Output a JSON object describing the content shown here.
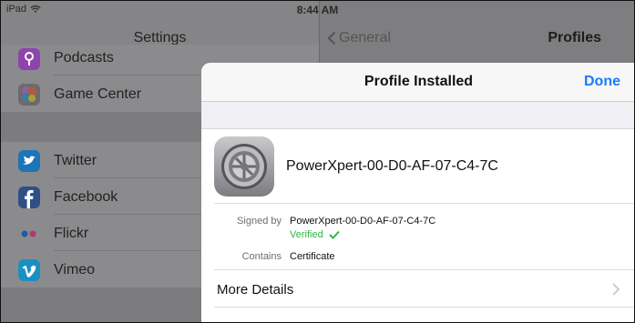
{
  "status": {
    "device": "iPad",
    "time": "8:44 AM"
  },
  "left": {
    "title": "Settings",
    "items": [
      {
        "label": "Podcasts",
        "icon": "podcasts-icon",
        "color": "#8e44ad"
      },
      {
        "label": "Game Center",
        "icon": "game-center-icon",
        "color": "#5b8b3a"
      },
      {
        "label": "Twitter",
        "icon": "twitter-icon",
        "color": "#1d74b8"
      },
      {
        "label": "Facebook",
        "icon": "facebook-icon",
        "color": "#2f4f86"
      },
      {
        "label": "Flickr",
        "icon": "flickr-icon",
        "color": "#7e7e80"
      },
      {
        "label": "Vimeo",
        "icon": "vimeo-icon",
        "color": "#1c8fc1"
      }
    ]
  },
  "right": {
    "back_label": "General",
    "title": "Profiles"
  },
  "sheet": {
    "title": "Profile Installed",
    "done_label": "Done",
    "profile_name": "PowerXpert-00-D0-AF-07-C4-7C",
    "signed_by_label": "Signed by",
    "signed_by_value": "PowerXpert-00-D0-AF-07-C4-7C",
    "verified_label": "Verified",
    "contains_label": "Contains",
    "contains_value": "Certificate",
    "more_details_label": "More Details"
  },
  "colors": {
    "accent": "#147efb",
    "verified": "#2fb945"
  }
}
